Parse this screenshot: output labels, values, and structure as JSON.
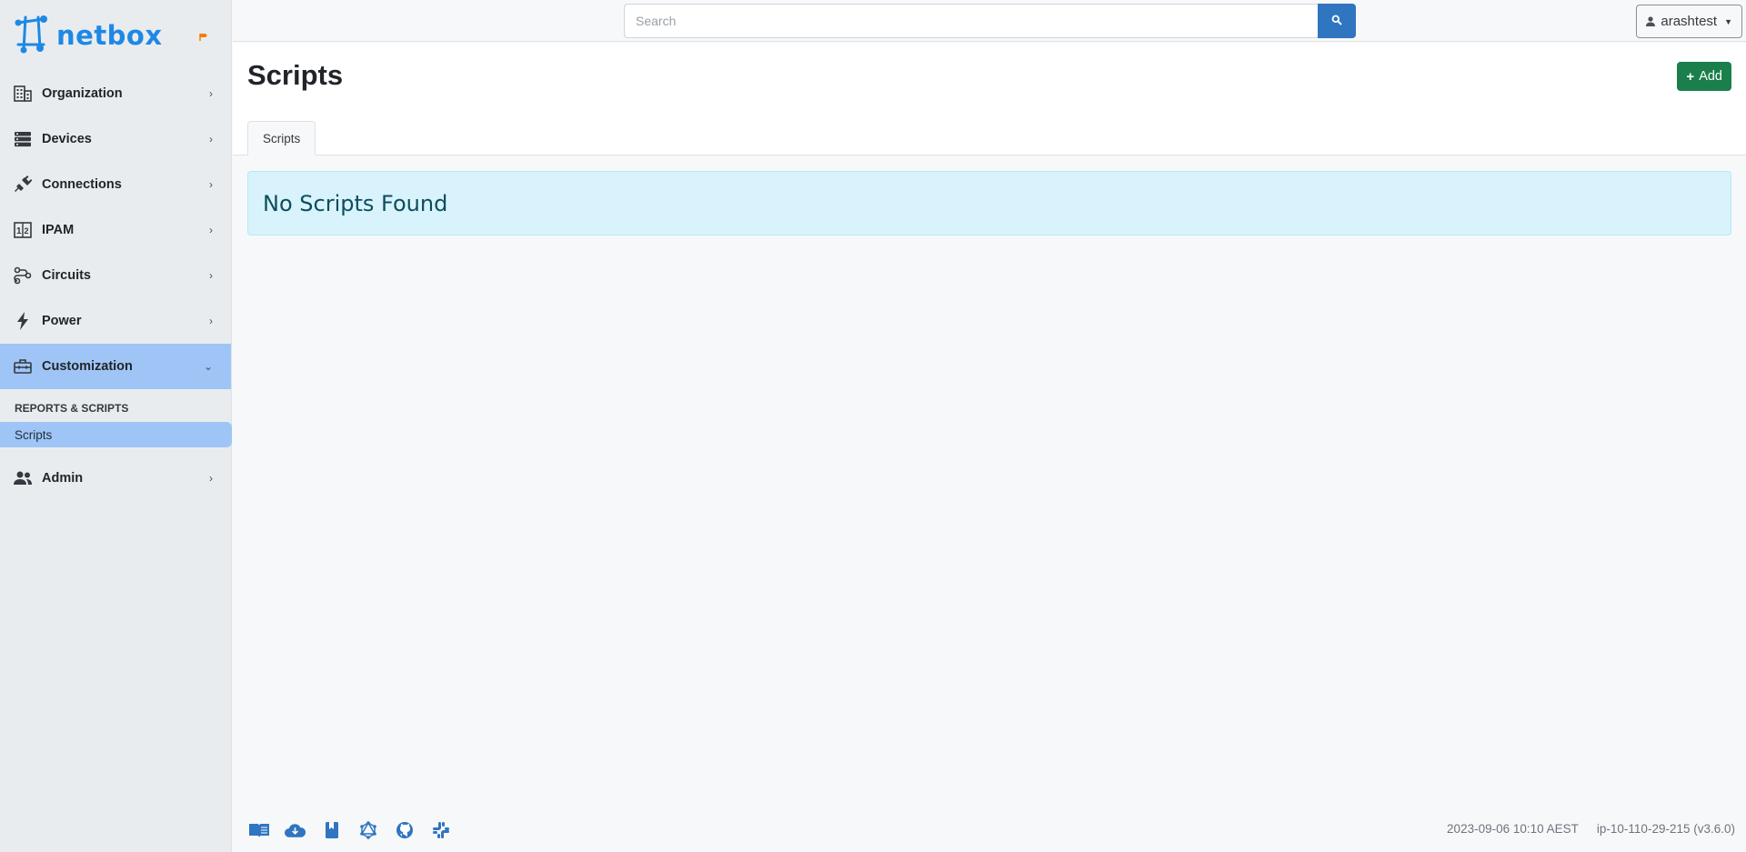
{
  "brand": {
    "name": "netbox"
  },
  "sidebar": {
    "items": [
      {
        "label": "Organization",
        "icon": "building-icon"
      },
      {
        "label": "Devices",
        "icon": "server-icon"
      },
      {
        "label": "Connections",
        "icon": "plug-icon"
      },
      {
        "label": "IPAM",
        "icon": "counter-icon"
      },
      {
        "label": "Circuits",
        "icon": "transit-connection-icon"
      },
      {
        "label": "Power",
        "icon": "flash-icon"
      },
      {
        "label": "Customization",
        "icon": "toolbox-icon",
        "expanded": true
      }
    ],
    "section_heading": "REPORTS & SCRIPTS",
    "sub_items": [
      {
        "label": "Scripts",
        "active": true
      }
    ],
    "admin": {
      "label": "Admin",
      "icon": "account-group-icon"
    }
  },
  "topbar": {
    "search_placeholder": "Search",
    "user": "arashtest"
  },
  "page": {
    "title": "Scripts",
    "add_label": "Add",
    "tab_label": "Scripts",
    "empty_message": "No Scripts Found"
  },
  "footer": {
    "timestamp": "2023-09-06 10:10 AEST",
    "host": "ip-10-110-29-215 (v3.6.0)",
    "icons": [
      "docs-icon",
      "api-icon",
      "book-icon",
      "graphql-icon",
      "github-icon",
      "slack-icon"
    ]
  },
  "colors": {
    "accent": "#1e88e5",
    "active_nav": "#9ec5f5",
    "add_button": "#1a7f4b",
    "search_button": "#2f75c0",
    "alert_bg": "#d8f3fb"
  }
}
